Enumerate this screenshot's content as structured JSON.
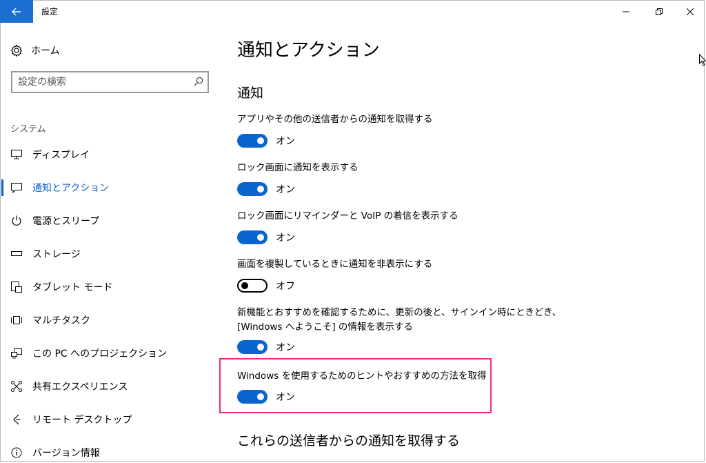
{
  "window": {
    "title": "設定"
  },
  "sidebar": {
    "home_label": "ホーム",
    "search_placeholder": "設定の検索",
    "section_label": "システム",
    "items": [
      {
        "label": "ディスプレイ",
        "icon": "monitor-icon"
      },
      {
        "label": "通知とアクション",
        "icon": "notification-icon",
        "active": true
      },
      {
        "label": "電源とスリープ",
        "icon": "power-icon"
      },
      {
        "label": "ストレージ",
        "icon": "storage-icon"
      },
      {
        "label": "タブレット モード",
        "icon": "tablet-mode-icon"
      },
      {
        "label": "マルチタスク",
        "icon": "multitask-icon"
      },
      {
        "label": "この PC へのプロジェクション",
        "icon": "projection-icon"
      },
      {
        "label": "共有エクスペリエンス",
        "icon": "shared-experience-icon"
      },
      {
        "label": "リモート デスクトップ",
        "icon": "remote-desktop-icon"
      },
      {
        "label": "バージョン情報",
        "icon": "info-icon"
      }
    ]
  },
  "main": {
    "page_title": "通知とアクション",
    "section_title": "通知",
    "settings": [
      {
        "label": "アプリやその他の送信者からの通知を取得する",
        "state": "オン",
        "on": true
      },
      {
        "label": "ロック画面に通知を表示する",
        "state": "オン",
        "on": true
      },
      {
        "label": "ロック画面にリマインダーと VoIP の着信を表示する",
        "state": "オン",
        "on": true
      },
      {
        "label": "画面を複製しているときに通知を非表示にする",
        "state": "オフ",
        "on": false
      },
      {
        "label_line1": "新機能とおすすめを確認するために、更新の後と、サインイン時にときどき、",
        "label_line2": "[Windows へようこそ] の情報を表示する",
        "state": "オン",
        "on": true
      },
      {
        "label": "Windows を使用するためのヒントやおすすめの方法を取得",
        "state": "オン",
        "on": true,
        "highlighted": true
      }
    ],
    "bottom_section_title": "これらの送信者からの通知を取得する"
  },
  "colors": {
    "accent": "#0a64d0",
    "back_button": "#1a6fd1",
    "highlight_border": "#e8316d"
  }
}
